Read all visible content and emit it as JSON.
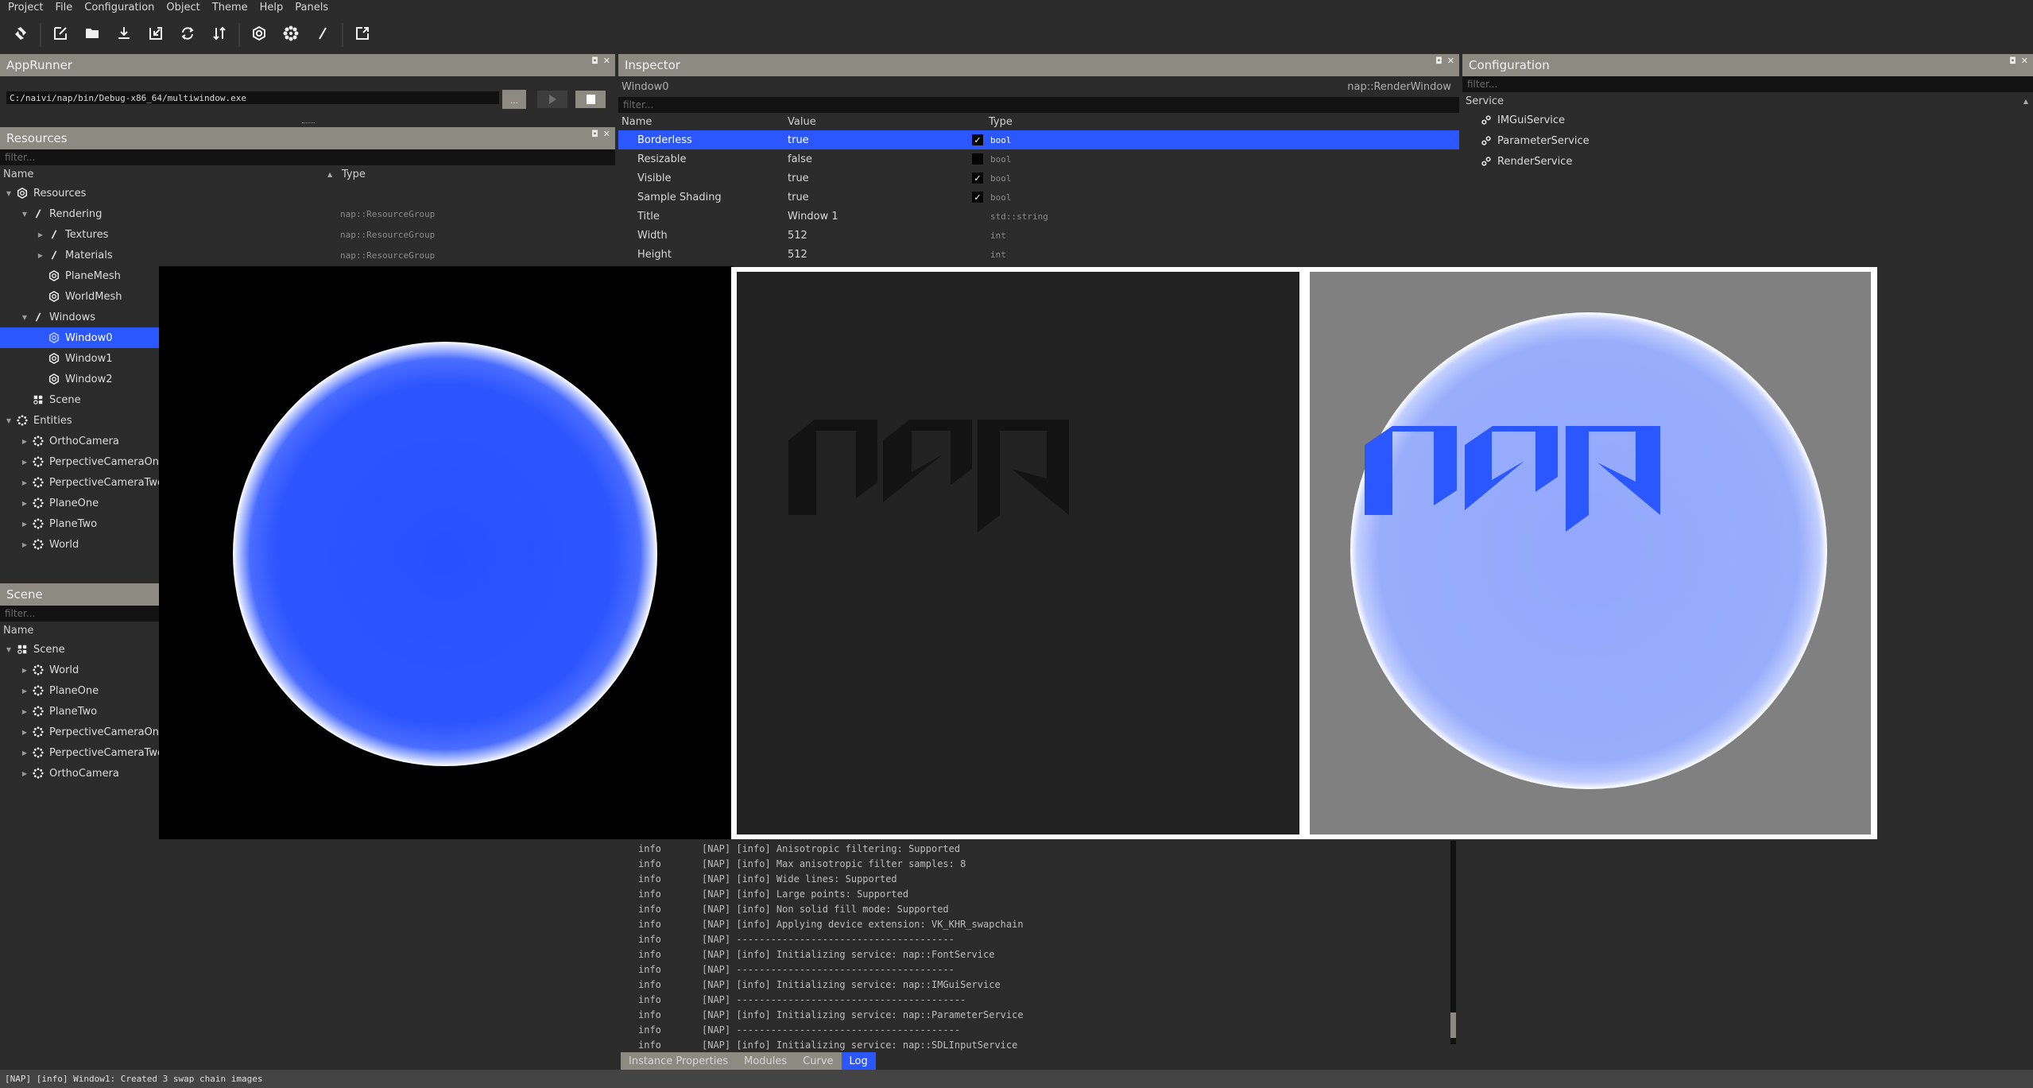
{
  "menu": [
    "Project",
    "File",
    "Configuration",
    "Object",
    "Theme",
    "Help",
    "Panels"
  ],
  "toolbar": [
    {
      "name": "napkin-logo-icon"
    },
    {
      "name": "new-file-icon"
    },
    {
      "name": "open-folder-icon"
    },
    {
      "name": "save-icon"
    },
    {
      "name": "save-as-icon"
    },
    {
      "name": "reload-icon"
    },
    {
      "name": "sort-icon"
    },
    {
      "name": "resource-icon"
    },
    {
      "name": "entity-icon"
    },
    {
      "name": "group-icon"
    },
    {
      "name": "external-link-icon"
    }
  ],
  "apprunner": {
    "title": "AppRunner",
    "path": "C:/naivi/nap/bin/Debug-x86_64/multiwindow.exe",
    "browse_label": "..."
  },
  "resources": {
    "title": "Resources",
    "filter_placeholder": "filter...",
    "col_name": "Name",
    "col_type": "Type",
    "items": [
      {
        "label": "Resources",
        "depth": 0,
        "arrow": "down",
        "icon": "resource",
        "type": ""
      },
      {
        "label": "Rendering",
        "depth": 1,
        "arrow": "down",
        "icon": "group",
        "type": "nap::ResourceGroup"
      },
      {
        "label": "Textures",
        "depth": 2,
        "arrow": "right",
        "icon": "group",
        "type": "nap::ResourceGroup"
      },
      {
        "label": "Materials",
        "depth": 2,
        "arrow": "right",
        "icon": "group",
        "type": "nap::ResourceGroup"
      },
      {
        "label": "PlaneMesh",
        "depth": 2,
        "arrow": "",
        "icon": "resource",
        "type": ""
      },
      {
        "label": "WorldMesh",
        "depth": 2,
        "arrow": "",
        "icon": "resource",
        "type": ""
      },
      {
        "label": "Windows",
        "depth": 1,
        "arrow": "down",
        "icon": "group",
        "type": ""
      },
      {
        "label": "Window0",
        "depth": 2,
        "arrow": "",
        "icon": "resource",
        "type": "",
        "selected": true
      },
      {
        "label": "Window1",
        "depth": 2,
        "arrow": "",
        "icon": "resource",
        "type": ""
      },
      {
        "label": "Window2",
        "depth": 2,
        "arrow": "",
        "icon": "resource",
        "type": ""
      },
      {
        "label": "Scene",
        "depth": 1,
        "arrow": "",
        "icon": "scene",
        "type": ""
      },
      {
        "label": "Entities",
        "depth": 0,
        "arrow": "down",
        "icon": "entity",
        "type": ""
      },
      {
        "label": "OrthoCamera",
        "depth": 1,
        "arrow": "right",
        "icon": "entity",
        "type": ""
      },
      {
        "label": "PerpectiveCameraOne",
        "depth": 1,
        "arrow": "right",
        "icon": "entity",
        "type": ""
      },
      {
        "label": "PerpectiveCameraTwo",
        "depth": 1,
        "arrow": "right",
        "icon": "entity",
        "type": ""
      },
      {
        "label": "PlaneOne",
        "depth": 1,
        "arrow": "right",
        "icon": "entity",
        "type": ""
      },
      {
        "label": "PlaneTwo",
        "depth": 1,
        "arrow": "right",
        "icon": "entity",
        "type": ""
      },
      {
        "label": "World",
        "depth": 1,
        "arrow": "right",
        "icon": "entity",
        "type": ""
      }
    ]
  },
  "scene": {
    "title": "Scene",
    "filter_placeholder": "filter...",
    "col_name": "Name",
    "items": [
      {
        "label": "Scene",
        "depth": 0,
        "arrow": "down",
        "icon": "scene"
      },
      {
        "label": "World",
        "depth": 1,
        "arrow": "right",
        "icon": "entity"
      },
      {
        "label": "PlaneOne",
        "depth": 1,
        "arrow": "right",
        "icon": "entity"
      },
      {
        "label": "PlaneTwo",
        "depth": 1,
        "arrow": "right",
        "icon": "entity"
      },
      {
        "label": "PerpectiveCameraOne",
        "depth": 1,
        "arrow": "right",
        "icon": "entity"
      },
      {
        "label": "PerpectiveCameraTwo",
        "depth": 1,
        "arrow": "right",
        "icon": "entity"
      },
      {
        "label": "OrthoCamera",
        "depth": 1,
        "arrow": "right",
        "icon": "entity"
      }
    ]
  },
  "inspector": {
    "title": "Inspector",
    "object_name": "Window0",
    "object_type": "nap::RenderWindow",
    "filter_placeholder": "filter...",
    "col_name": "Name",
    "col_value": "Value",
    "col_type": "Type",
    "rows": [
      {
        "name": "Borderless",
        "value": "true",
        "check": "checked",
        "type": "bool",
        "selected": true
      },
      {
        "name": "Resizable",
        "value": "false",
        "check": "unchecked",
        "type": "bool"
      },
      {
        "name": "Visible",
        "value": "true",
        "check": "checked",
        "type": "bool"
      },
      {
        "name": "Sample Shading",
        "value": "true",
        "check": "checked",
        "type": "bool"
      },
      {
        "name": "Title",
        "value": "Window 1",
        "check": "",
        "type": "std::string"
      },
      {
        "name": "Width",
        "value": "512",
        "check": "",
        "type": "int"
      },
      {
        "name": "Height",
        "value": "512",
        "check": "",
        "type": "int"
      }
    ]
  },
  "log": {
    "rows": [
      {
        "level": "info",
        "msg": "[NAP] [info] Anisotropic filtering: Supported"
      },
      {
        "level": "info",
        "msg": "[NAP] [info] Max anisotropic filter samples: 8"
      },
      {
        "level": "info",
        "msg": "[NAP] [info] Wide lines: Supported"
      },
      {
        "level": "info",
        "msg": "[NAP] [info] Large points: Supported"
      },
      {
        "level": "info",
        "msg": "[NAP] [info] Non solid fill mode: Supported"
      },
      {
        "level": "info",
        "msg": "[NAP] [info] Applying device extension: VK_KHR_swapchain"
      },
      {
        "level": "info",
        "msg": "[NAP] --------------------------------------"
      },
      {
        "level": "info",
        "msg": "[NAP] [info] Initializing service: nap::FontService"
      },
      {
        "level": "info",
        "msg": "[NAP] --------------------------------------"
      },
      {
        "level": "info",
        "msg": "[NAP] [info] Initializing service: nap::IMGuiService"
      },
      {
        "level": "info",
        "msg": "[NAP] ----------------------------------------"
      },
      {
        "level": "info",
        "msg": "[NAP] [info] Initializing service: nap::ParameterService"
      },
      {
        "level": "info",
        "msg": "[NAP] ---------------------------------------"
      },
      {
        "level": "info",
        "msg": "[NAP] [info] Initializing service: nap::SDLInputService"
      }
    ]
  },
  "bottom_tabs": [
    {
      "label": "Instance Properties"
    },
    {
      "label": "Modules"
    },
    {
      "label": "Curve"
    },
    {
      "label": "Log",
      "active": true
    }
  ],
  "configuration": {
    "title": "Configuration",
    "filter_placeholder": "filter...",
    "col_service": "Service",
    "services": [
      "IMGuiService",
      "ParameterService",
      "RenderService"
    ]
  },
  "render_windows": [
    {
      "name": "Window0",
      "content": "blue-globe"
    },
    {
      "name": "Window1",
      "content": "nap-logo-dark"
    },
    {
      "name": "Window2",
      "content": "nap-logo-on-globe"
    }
  ],
  "statusbar": {
    "message": "[NAP] [info] Window1: Created 3 swap chain images"
  },
  "colors": {
    "accent": "#2a57ff",
    "panel_title": "#8d8a82",
    "background": "#2b2b2b"
  }
}
